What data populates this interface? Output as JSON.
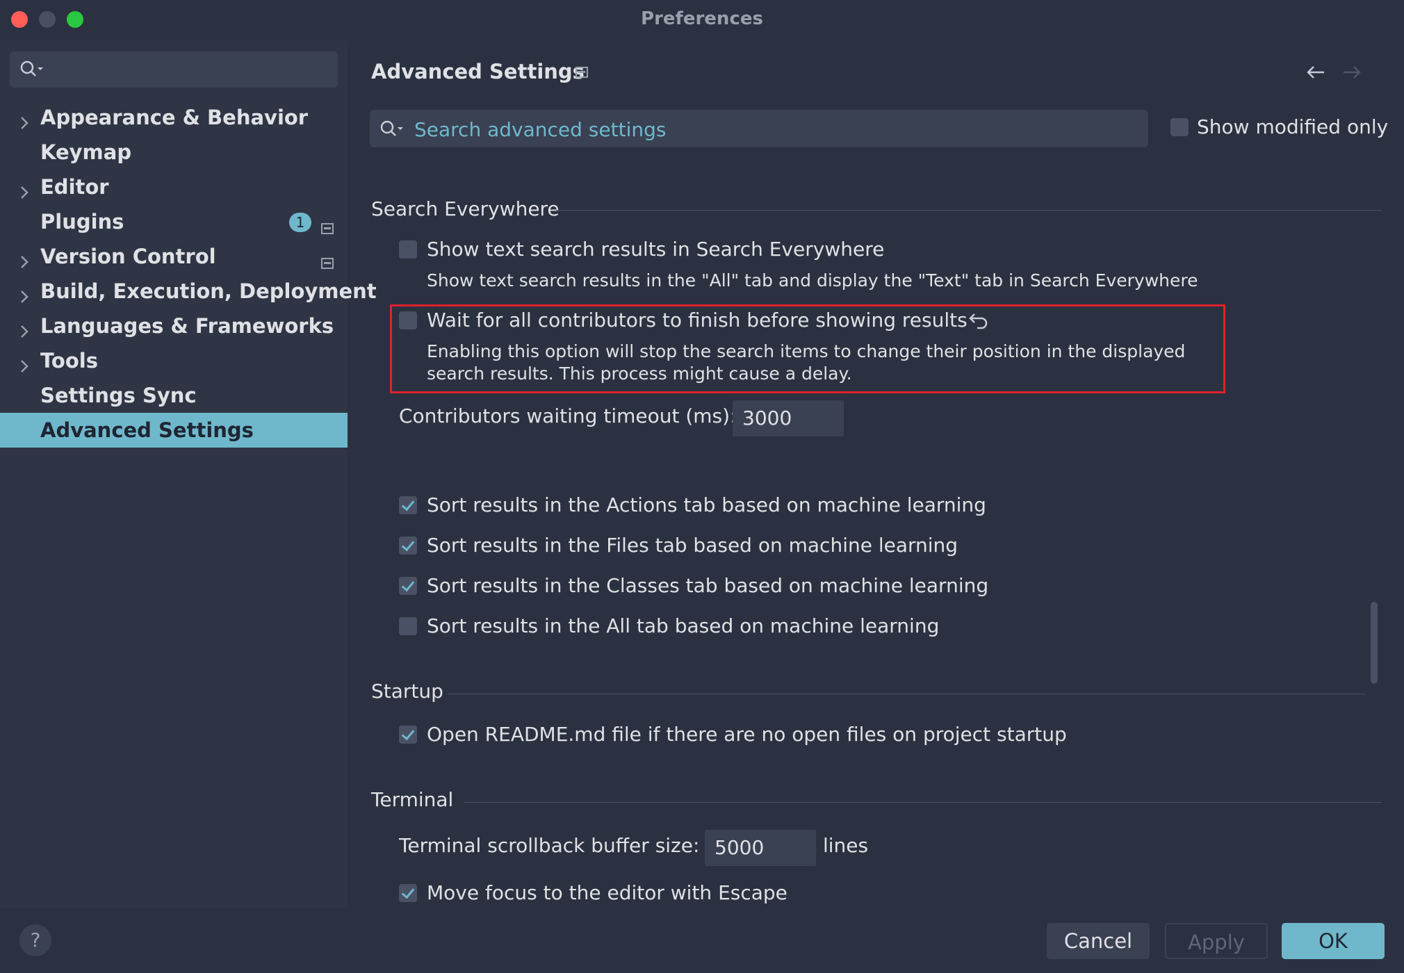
{
  "window": {
    "title": "Preferences"
  },
  "sidebar": {
    "search_placeholder": "",
    "items": [
      {
        "label": "Appearance & Behavior",
        "expandable": true
      },
      {
        "label": "Keymap",
        "expandable": false
      },
      {
        "label": "Editor",
        "expandable": true
      },
      {
        "label": "Plugins",
        "expandable": false,
        "badge": "1"
      },
      {
        "label": "Version Control",
        "expandable": true
      },
      {
        "label": "Build, Execution, Deployment",
        "expandable": true
      },
      {
        "label": "Languages & Frameworks",
        "expandable": true
      },
      {
        "label": "Tools",
        "expandable": true
      },
      {
        "label": "Settings Sync",
        "expandable": false
      },
      {
        "label": "Advanced Settings",
        "expandable": false,
        "selected": true
      }
    ]
  },
  "main": {
    "title": "Advanced Settings",
    "search_placeholder": "Search advanced settings",
    "show_modified_only": {
      "label": "Show modified only",
      "checked": false
    },
    "sections": {
      "search_everywhere": {
        "title": "Search Everywhere",
        "show_text_results": {
          "label": "Show text search results in Search Everywhere",
          "desc": "Show text search results in the \"All\" tab and display the \"Text\" tab in Search Everywhere",
          "checked": false
        },
        "wait_contributors": {
          "label": "Wait for all contributors to finish before showing results",
          "desc_line1": "Enabling this option will stop the search items to change their position in the displayed",
          "desc_line2": "search results. This process might cause a delay.",
          "checked": false
        },
        "timeout": {
          "label": "Contributors waiting timeout (ms):",
          "value": "3000"
        },
        "sort_actions": {
          "label": "Sort results in the Actions tab based on machine learning",
          "checked": true
        },
        "sort_files": {
          "label": "Sort results in the Files tab based on machine learning",
          "checked": true
        },
        "sort_classes": {
          "label": "Sort results in the Classes tab based on machine learning",
          "checked": true
        },
        "sort_all": {
          "label": "Sort results in the All tab based on machine learning",
          "checked": false
        }
      },
      "startup": {
        "title": "Startup",
        "open_readme": {
          "label": "Open README.md file if there are no open files on project startup",
          "checked": true
        }
      },
      "terminal": {
        "title": "Terminal",
        "scrollback": {
          "label": "Terminal scrollback buffer size:",
          "value": "5000",
          "unit": "lines"
        },
        "escape_focus": {
          "label": "Move focus to the editor with Escape",
          "checked": true
        }
      }
    }
  },
  "footer": {
    "help": "?",
    "cancel": "Cancel",
    "apply": "Apply",
    "ok": "OK"
  },
  "colors": {
    "accent": "#6fb8cc",
    "highlight": "#e0212b",
    "background": "#2b3140"
  }
}
